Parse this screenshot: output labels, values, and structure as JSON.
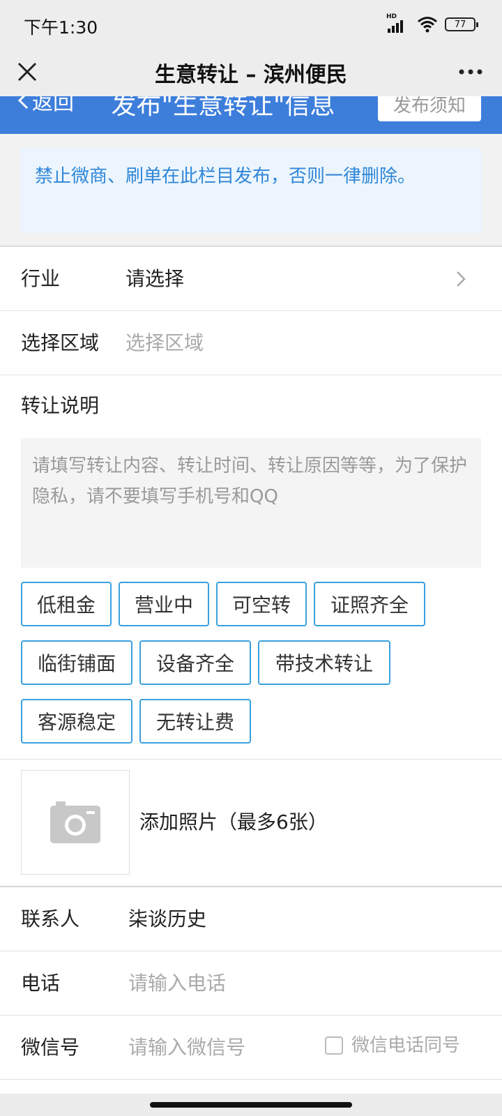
{
  "status_bar": {
    "time": "下午1:30",
    "hd": "HD",
    "battery": "77"
  },
  "title_bar": {
    "title": "生意转让 – 滨州便民"
  },
  "header": {
    "back_label": "返回",
    "title": "发布\"生意转让\"信息",
    "notice_button": "发布须知"
  },
  "notice": {
    "text": "禁止微商、刷单在此栏目发布，否则一律删除。"
  },
  "form": {
    "industry": {
      "label": "行业",
      "value": "请选择"
    },
    "region": {
      "label": "选择区域",
      "placeholder": "选择区域"
    },
    "description": {
      "label": "转让说明",
      "placeholder": "请填写转让内容、转让时间、转让原因等等，为了保护隐私，请不要填写手机号和QQ"
    },
    "tags": [
      "低租金",
      "营业中",
      "可空转",
      "证照齐全",
      "临街铺面",
      "设备齐全",
      "带技术转让",
      "客源稳定",
      "无转让费"
    ],
    "photo": {
      "label": "添加照片（最多6张）"
    },
    "contact": {
      "label": "联系人",
      "value": "柒谈历史"
    },
    "phone": {
      "label": "电话",
      "placeholder": "请输入电话"
    },
    "wechat": {
      "label": "微信号",
      "placeholder": "请输入微信号",
      "same_as_phone_label": "微信电话同号",
      "same_as_phone_checked": false
    }
  },
  "colors": {
    "accent_blue": "#3d7edb",
    "tag_border": "#3aa0df",
    "notice_text": "#2f86d8"
  }
}
